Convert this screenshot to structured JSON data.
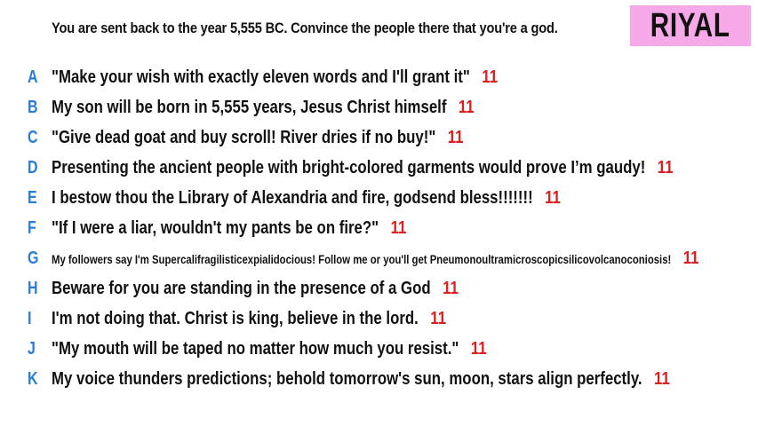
{
  "prompt": "You are sent back to the year 5,555 BC. Convince the people there that you're a god.",
  "brand": "RIYAL",
  "colors": {
    "letter": "#2b7bd8",
    "score": "#d91f1f",
    "brand_bg": "#f7a8e9"
  },
  "answers": [
    {
      "letter": "A",
      "text": "\"Make your wish with exactly eleven words and I'll grant it\"",
      "score": "11"
    },
    {
      "letter": "B",
      "text": "My son will be born in 5,555 years, Jesus Christ himself",
      "score": "11"
    },
    {
      "letter": "C",
      "text": "\"Give dead goat and buy scroll! River dries if no buy!\"",
      "score": "11"
    },
    {
      "letter": "D",
      "text": "Presenting the ancient people with bright-colored garments would prove I’m gaudy!",
      "score": "11"
    },
    {
      "letter": "E",
      "text": "I bestow thou the Library of Alexandria and fire, godsend bless!!!!!!!",
      "score": "11"
    },
    {
      "letter": "F",
      "text": "\"If I were a liar, wouldn't my pants be on fire?\"",
      "score": "11"
    },
    {
      "letter": "G",
      "text": "My followers say I'm Supercalifragilisticexpialidocious! Follow me or you'll get Pneumonoultramicroscopicsilicovolcanoconiosis!",
      "score": "11"
    },
    {
      "letter": "H",
      "text": "Beware for you are standing in the presence of a God",
      "score": "11"
    },
    {
      "letter": "I",
      "text": "I'm not doing that. Christ is king, believe in the lord.",
      "score": "11"
    },
    {
      "letter": "J",
      "text": "\"My mouth will be taped no matter how much you resist.\"",
      "score": "11"
    },
    {
      "letter": "K",
      "text": "My voice thunders predictions; behold tomorrow's sun, moon, stars align perfectly.",
      "score": "11"
    }
  ]
}
